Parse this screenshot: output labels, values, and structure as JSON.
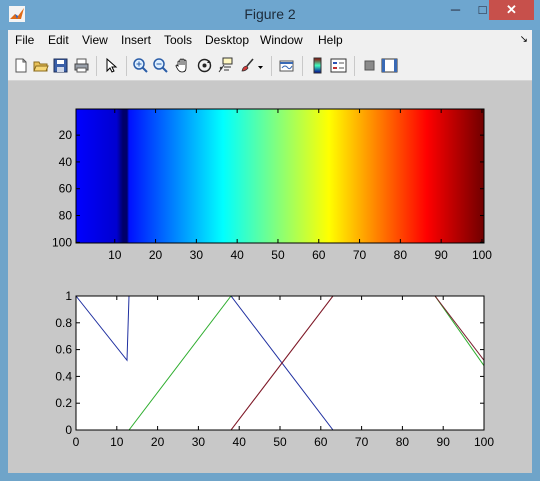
{
  "window": {
    "title": "Figure 2",
    "controls": {
      "minimize": "─",
      "maximize": "□",
      "close": "✕"
    }
  },
  "menubar": {
    "items": [
      "File",
      "Edit",
      "View",
      "Insert",
      "Tools",
      "Desktop",
      "Window",
      "Help"
    ],
    "dock_icon": "dock-arrow-icon"
  },
  "toolbar": {
    "buttons": [
      "new-figure-icon",
      "open-file-icon",
      "save-icon",
      "print-icon",
      "edit-plot-arrow-icon",
      "zoom-in-icon",
      "zoom-out-icon",
      "pan-hand-icon",
      "rotate-3d-icon",
      "data-cursor-icon",
      "brush-icon",
      "link-plot-icon",
      "colorbar-icon",
      "legend-icon",
      "hide-plot-tools-icon",
      "show-plot-tools-icon"
    ]
  },
  "chart_data": [
    {
      "type": "heatmap",
      "colormap": "jet",
      "x": {
        "lim": [
          0.5,
          100.5
        ],
        "ticks": [
          10,
          20,
          30,
          40,
          50,
          60,
          70,
          80,
          90,
          100
        ]
      },
      "y": {
        "lim": [
          0.5,
          100.5
        ],
        "ticks": [
          20,
          40,
          60,
          80,
          100
        ],
        "direction": "reverse"
      },
      "n_columns": 100,
      "values": "column index 1-100 (each column constant down the rows)",
      "column_values": [
        1,
        100
      ],
      "notes": "colors vary left-to-right from dark blue through cyan, yellow, red to dark red; a darker navy band occurs near column 12-13",
      "grid": false
    },
    {
      "type": "line",
      "xlim": [
        0,
        100
      ],
      "ylim": [
        0,
        1
      ],
      "x_ticks": [
        0,
        10,
        20,
        30,
        40,
        50,
        60,
        70,
        80,
        90,
        100
      ],
      "y_ticks": [
        0,
        0.2,
        0.4,
        0.6,
        0.8,
        1
      ],
      "series": [
        {
          "color": "#1f2fa0",
          "x": [
            0,
            12.5,
            13,
            38,
            63,
            100
          ],
          "y": [
            1,
            0.52,
            1,
            1,
            0,
            0
          ]
        },
        {
          "color": "#2fae2f",
          "x": [
            0,
            13,
            38,
            88,
            100
          ],
          "y": [
            0,
            0,
            1,
            1,
            0.48
          ]
        },
        {
          "color": "#c03030",
          "x": [
            0,
            38,
            63,
            100
          ],
          "y": [
            0,
            0,
            1,
            1
          ]
        },
        {
          "color": "#7a1f2f",
          "x": [
            38,
            63,
            88,
            100
          ],
          "y": [
            0,
            1,
            1,
            0.52
          ]
        }
      ],
      "grid": false
    }
  ],
  "colors": {
    "figure_bg": "#c8c8c8",
    "window_frame": "#6fa4c9",
    "close_button": "#c7504b"
  }
}
